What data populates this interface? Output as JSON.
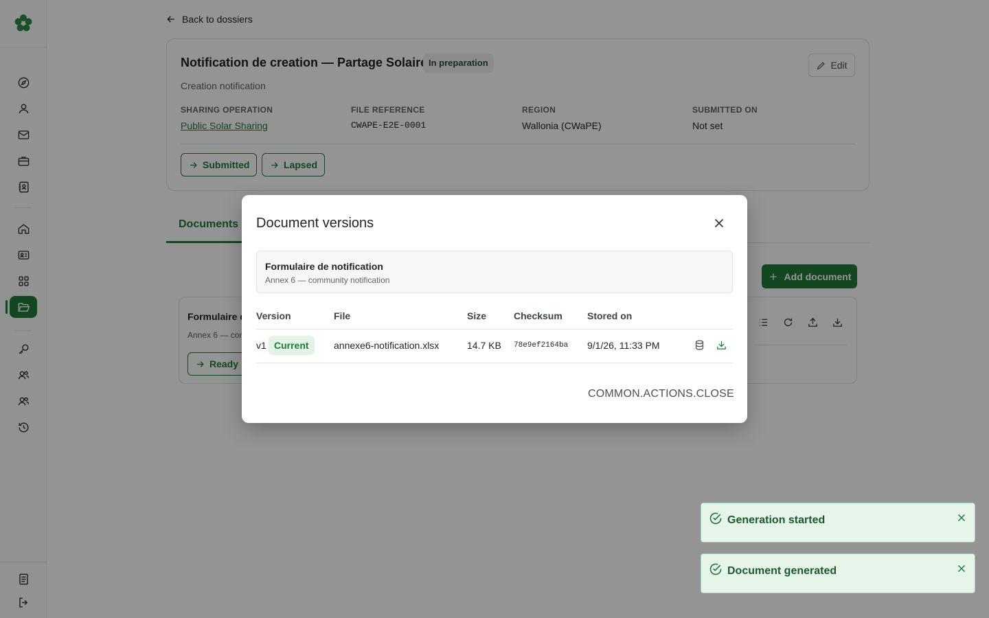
{
  "nav": {
    "back_label": "Back to dossiers"
  },
  "dossier": {
    "title": "Notification de creation — Partage Solaire",
    "status": "In preparation",
    "subtitle": "Creation notification",
    "edit_label": "Edit",
    "fields": [
      {
        "label": "SHARING OPERATION",
        "value": "Public Solar Sharing"
      },
      {
        "label": "FILE REFERENCE",
        "value": "CWAPE-E2E-0001"
      },
      {
        "label": "REGION",
        "value": "Wallonia (CWaPE)"
      },
      {
        "label": "SUBMITTED ON",
        "value": "Not set"
      }
    ],
    "transitions": [
      "Submitted",
      "Lapsed"
    ]
  },
  "tabs": {
    "documents": "Documents"
  },
  "documents": {
    "add_label": "Add document",
    "items": [
      {
        "name": "Formulaire d",
        "subtitle": "Annex 6 — com",
        "status": "Ready"
      }
    ]
  },
  "modal": {
    "title": "Document versions",
    "doc_title": "Formulaire de notification",
    "doc_subtitle": "Annex 6 — community notification",
    "columns": [
      "Version",
      "File",
      "Size",
      "Checksum",
      "Stored on"
    ],
    "rows": [
      {
        "version": "v1",
        "badge": "Current",
        "file": "annexe6-notification.xlsx",
        "size": "14.7 KB",
        "checksum": "78e9ef2164ba",
        "stored_on": "9/1/26, 11:33 PM"
      }
    ],
    "close_label": "COMMON.ACTIONS.CLOSE"
  },
  "toasts": [
    {
      "text": "Generation started"
    },
    {
      "text": "Document generated"
    }
  ],
  "colors": {
    "accent": "#1f7a3a",
    "toast_bg": "#e7f4ea"
  }
}
